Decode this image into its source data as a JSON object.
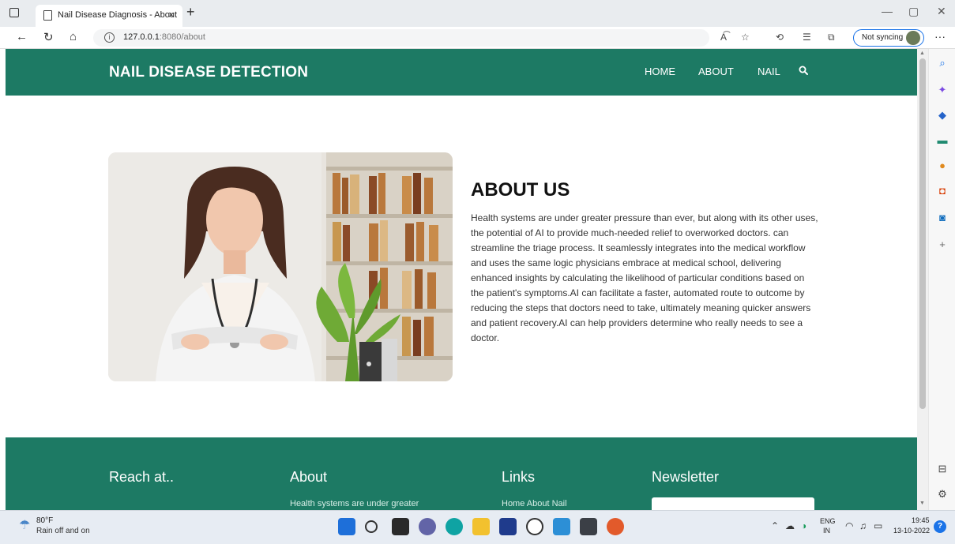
{
  "browser": {
    "tab_title": "Nail Disease Diagnosis - About",
    "tab_close": "×",
    "new_tab": "+",
    "url_host": "127.0.0.1",
    "url_path": ":8080/about",
    "sync_label": "Not syncing",
    "more": "···",
    "window_controls": {
      "minimize": "—",
      "restore": "▢",
      "close": "✕"
    }
  },
  "site": {
    "brand": "NAIL DISEASE DETECTION",
    "nav": {
      "home": "HOME",
      "about": "ABOUT",
      "nail": "NAIL"
    },
    "about_title": "ABOUT US",
    "about_text": "Health systems are under greater pressure than ever, but along with its other uses, the potential of AI to provide much-needed relief to overworked doctors. can streamline the triage process. It seamlessly integrates into the medical workflow and uses the same logic physicians embrace at medical school, delivering enhanced insights by calculating the likelihood of particular conditions based on the patient's symptoms.AI can facilitate a faster, automated route to outcome by reducing the steps that doctors need to take, ultimately meaning quicker answers and patient recovery.AI can help providers determine who really needs to see a doctor.",
    "footer": {
      "reach": "Reach at..",
      "about": "About",
      "about_sub": "Health systems are under greater",
      "links": "Links",
      "links_sub": "Home   About   Nail",
      "newsletter": "Newsletter"
    }
  },
  "taskbar": {
    "temp": "80°F",
    "weather": "Rain off and on",
    "lang_top": "ENG",
    "lang_bottom": "IN",
    "time": "19:45",
    "date": "13-10-2022"
  },
  "colors": {
    "brand_green": "#1d7a64",
    "accent_blue": "#1a73e8"
  }
}
